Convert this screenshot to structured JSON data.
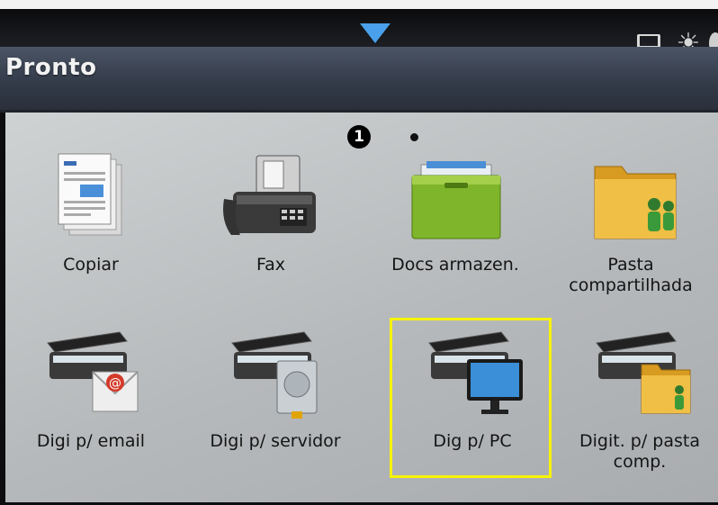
{
  "status": {
    "pull_tab_icon": "down-arrow-tab-icon",
    "icons": [
      "paper-tray-icon",
      "brightness-icon"
    ]
  },
  "header": {
    "title": "Pronto"
  },
  "pager": {
    "current_page": "1",
    "total_pages": 2
  },
  "apps": [
    {
      "label": "Copiar",
      "icon": "copy-document-icon"
    },
    {
      "label": "Fax",
      "icon": "fax-machine-icon"
    },
    {
      "label": "Docs armazen.",
      "icon": "stored-docs-box-icon"
    },
    {
      "label": "Pasta compartilhada",
      "icon": "shared-folder-icon"
    },
    {
      "label": "Digi p/ email",
      "icon": "scan-to-email-icon"
    },
    {
      "label": "Digi p/ servidor",
      "icon": "scan-to-server-icon"
    },
    {
      "label": "Dig p/ PC",
      "icon": "scan-to-pc-icon",
      "selected": true
    },
    {
      "label": "Digit. p/ pasta comp.",
      "icon": "scan-to-shared-folder-icon"
    }
  ],
  "colors": {
    "accent": "#4aa0ea",
    "highlight": "#f7f300",
    "title_bar": "#3a4250"
  }
}
